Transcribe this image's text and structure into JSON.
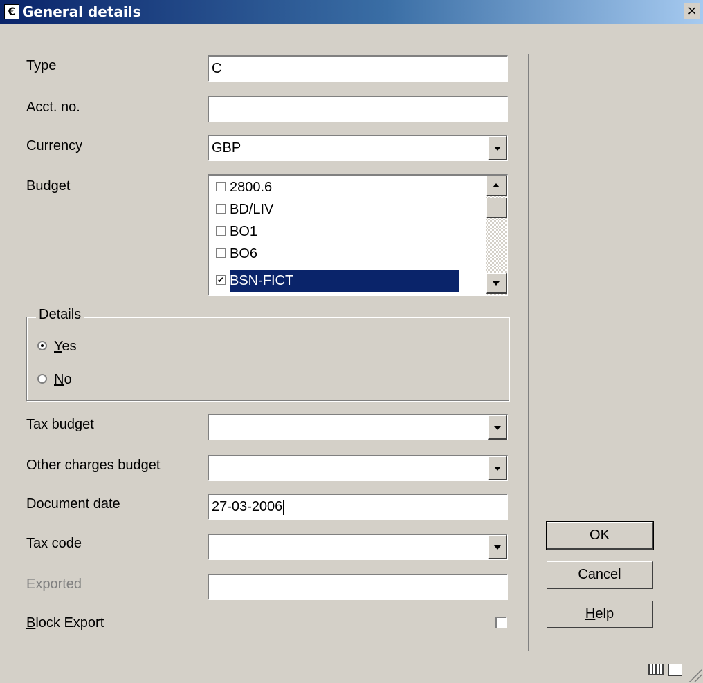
{
  "window": {
    "title": "General details",
    "app_icon_glyph": "€",
    "close_glyph": "×"
  },
  "form": {
    "type": {
      "label": "Type",
      "value": "C"
    },
    "acct_no": {
      "label": "Acct. no.",
      "value": ""
    },
    "currency": {
      "label": "Currency",
      "value": "GBP"
    },
    "budget": {
      "label": "Budget",
      "items": [
        {
          "label": "2800.6",
          "checked": false,
          "selected": false
        },
        {
          "label": "BD/LIV",
          "checked": false,
          "selected": false
        },
        {
          "label": "BO1",
          "checked": false,
          "selected": false
        },
        {
          "label": "BO6",
          "checked": false,
          "selected": false
        },
        {
          "label": "BSN-FICT",
          "checked": true,
          "selected": true
        }
      ]
    },
    "details": {
      "legend": "Details",
      "yes_accel": "Y",
      "yes_rest": "es",
      "no_accel": "N",
      "no_rest": "o",
      "selected": "yes"
    },
    "tax_budget": {
      "label": "Tax budget",
      "value": ""
    },
    "other_charges_budget": {
      "label": "Other charges budget",
      "value": ""
    },
    "document_date": {
      "label": "Document date",
      "value": "27-03-2006"
    },
    "tax_code": {
      "label": "Tax code",
      "value": ""
    },
    "exported": {
      "label": "Exported",
      "value": ""
    },
    "block_export": {
      "label_accel": "B",
      "label_rest": "lock Export",
      "checked": false
    }
  },
  "buttons": {
    "ok": "OK",
    "cancel": "Cancel",
    "help_accel": "H",
    "help_rest": "elp"
  },
  "checkmark": "✔",
  "colors": {
    "titlebar_start": "#0a246a",
    "dialog_bg": "#d4d0c8",
    "selection": "#0a246a"
  }
}
